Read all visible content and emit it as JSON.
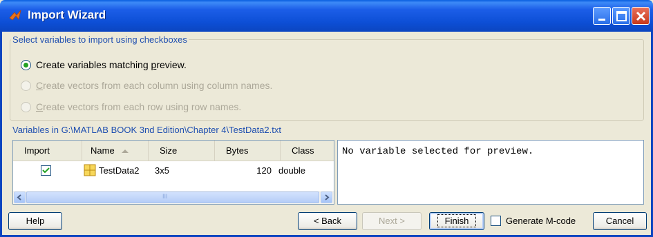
{
  "window": {
    "title": "Import Wizard"
  },
  "group": {
    "legend": "Select variables to import using checkboxes",
    "options": [
      {
        "pre": "Create variables matching ",
        "mnemonic": "p",
        "post": "review.",
        "checked": true,
        "enabled": true
      },
      {
        "pre": "",
        "mnemonic": "C",
        "post": "reate vectors from each column using column names.",
        "checked": false,
        "enabled": false
      },
      {
        "pre": "",
        "mnemonic": "C",
        "post": "reate vectors from each row using row names.",
        "checked": false,
        "enabled": false
      }
    ]
  },
  "variables_label": "Variables in G:\\MATLAB BOOK 3nd Edition\\Chapter 4\\TestData2.txt",
  "table": {
    "columns": [
      "Import",
      "Name",
      "Size",
      "Bytes",
      "Class"
    ],
    "rows": [
      {
        "import": true,
        "name": "TestData2",
        "size": "3x5",
        "bytes": "120",
        "class": "double"
      }
    ],
    "scrollbar_thumb_glyph": "III"
  },
  "preview": {
    "text": "No variable selected for preview."
  },
  "buttons": {
    "help": "Help",
    "back": "< Back",
    "next": "Next >",
    "finish": "Finish",
    "generate": "Generate M-code",
    "cancel": "Cancel"
  },
  "colors": {
    "accent": "#1f4fb0",
    "titlebar": "#0b45c0",
    "radio_dot": "#21a121",
    "check_mark": "#21a121"
  },
  "icons": {
    "app": "matlab-logo-icon",
    "variable": "matrix-grid-icon"
  }
}
